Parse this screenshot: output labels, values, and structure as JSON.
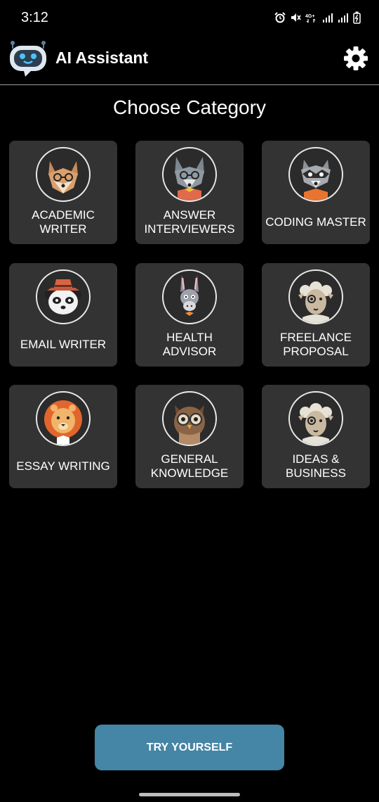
{
  "status_bar": {
    "time": "3:12",
    "network": "4G+"
  },
  "header": {
    "title": "AI Assistant",
    "logo_icon": "robot-chat-icon",
    "settings_icon": "gear-icon"
  },
  "page": {
    "title": "Choose Category"
  },
  "categories": [
    {
      "label": "ACADEMIC\nWRITER",
      "icon": "fox-glasses-icon"
    },
    {
      "label": "ANSWER\nINTERVIEWERS",
      "icon": "wolf-glasses-icon"
    },
    {
      "label": "CODING MASTER",
      "icon": "raccoon-icon"
    },
    {
      "label": "EMAIL WRITER",
      "icon": "panda-hat-icon"
    },
    {
      "label": "HEALTH ADVISOR",
      "icon": "donkey-icon"
    },
    {
      "label": "FREELANCE\nPROPOSAL",
      "icon": "sheep-monocle-icon"
    },
    {
      "label": "ESSAY WRITING",
      "icon": "lion-icon"
    },
    {
      "label": "GENERAL\nKNOWLEDGE",
      "icon": "owl-glasses-icon"
    },
    {
      "label": "IDEAS &\nBUSINESS",
      "icon": "sheep-monocle-icon"
    }
  ],
  "footer": {
    "try_label": "TRY YOURSELF"
  },
  "colors": {
    "background": "#000000",
    "card": "#333333",
    "accent": "#4585a5"
  }
}
